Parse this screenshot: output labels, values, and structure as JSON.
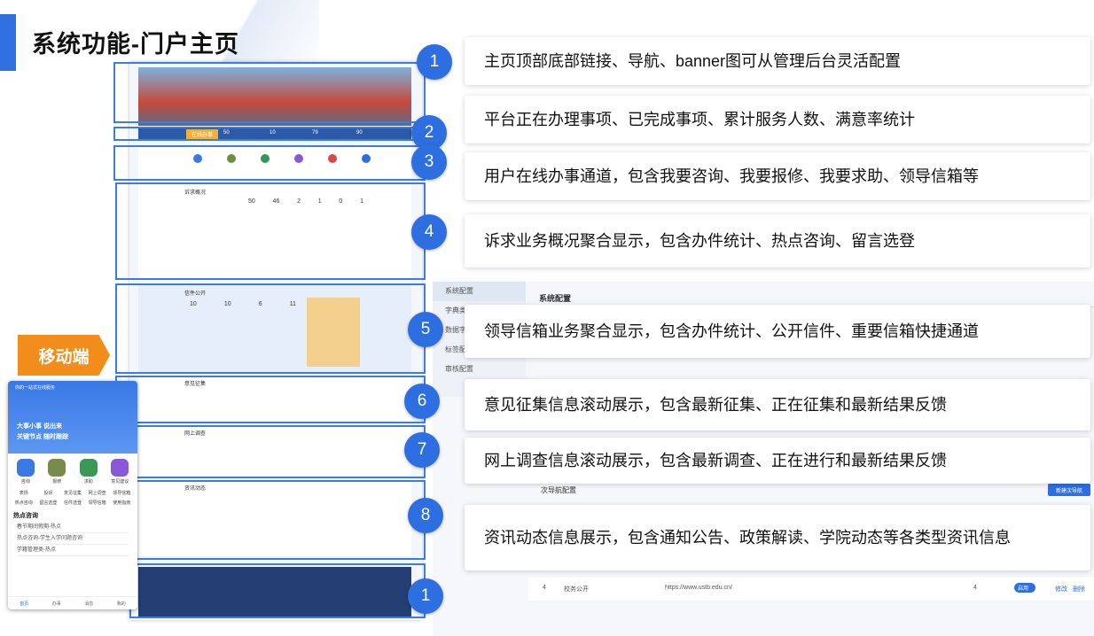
{
  "title": "系统功能-门户主页",
  "mobile_label": "移动端",
  "colors": {
    "accent": "#2f6fe0",
    "badge": "#2d6fe0",
    "mobile_tag": "#f28c1b"
  },
  "features": [
    {
      "num": "1",
      "text": "主页顶部底部链接、导航、banner图可从管理后台灵活配置"
    },
    {
      "num": "2",
      "text": "平台正在办理事项、已完成事项、累计服务人数、满意率统计"
    },
    {
      "num": "3",
      "text": "用户在线办事通道，包含我要咨询、我要报修、我要求助、领导信箱等"
    },
    {
      "num": "4",
      "text": "诉求业务概况聚合显示，包含办件统计、热点咨询、留言选登"
    },
    {
      "num": "5",
      "text": "领导信箱业务聚合显示，包含办件统计、公开信件、重要信箱快捷通道"
    },
    {
      "num": "6",
      "text": "意见征集信息滚动展示，包含最新征集、正在征集和最新结果反馈"
    },
    {
      "num": "7",
      "text": "网上调查信息滚动展示，包含最新调查、正在进行和最新结果反馈"
    },
    {
      "num": "8",
      "text": "资讯动态信息展示，包含通知公告、政策解读、学院动态等各类型资讯信息"
    },
    {
      "num": "1",
      "text": ""
    }
  ],
  "portal": {
    "banner_button": "在线办事",
    "stats": [
      "50",
      "10",
      "79",
      "90"
    ],
    "sections": {
      "appeal_overview": "诉求概况",
      "appeal_numbers": [
        "50",
        "46",
        "2",
        "1",
        "0",
        "1"
      ],
      "letters": "信件公开",
      "letter_numbers": [
        "10",
        "10",
        "6",
        "11"
      ],
      "opinion": "意见征集",
      "survey": "网上调查",
      "news": "资讯动态"
    }
  },
  "admin": {
    "sidebar": [
      "系统配置",
      "字典类型",
      "数据字典",
      "标签配置",
      "审核配置"
    ],
    "header": "系统配置",
    "subnav_title": "次导航配置",
    "new_button": "新建次导航",
    "row": {
      "index": "4",
      "name": "校务公开",
      "url": "https://www.ustb.edu.cn/",
      "order": "4",
      "status": "启用",
      "edit": "修改",
      "delete": "删除"
    }
  },
  "mobile": {
    "header": "你的一站式在线服务",
    "slogan1": "大事小事 说出来",
    "slogan2": "关键节点 随时跟踪",
    "main_icons": [
      "咨询",
      "报修",
      "求助",
      "意见建议"
    ],
    "sub_icons": [
      "表扬",
      "投诉",
      "意见征集",
      "网上调查",
      "领导信箱",
      "热点咨询",
      "留言选登",
      "信件选登",
      "领导信箱",
      "使用指南"
    ],
    "hot_title": "热点咨询",
    "hot_items": [
      "春节期间假期-热点",
      "热点咨询-学生入学问题咨询",
      "学籍管理类-热点"
    ],
    "tabs": [
      "首页",
      "办事",
      "消息",
      "我的"
    ]
  }
}
